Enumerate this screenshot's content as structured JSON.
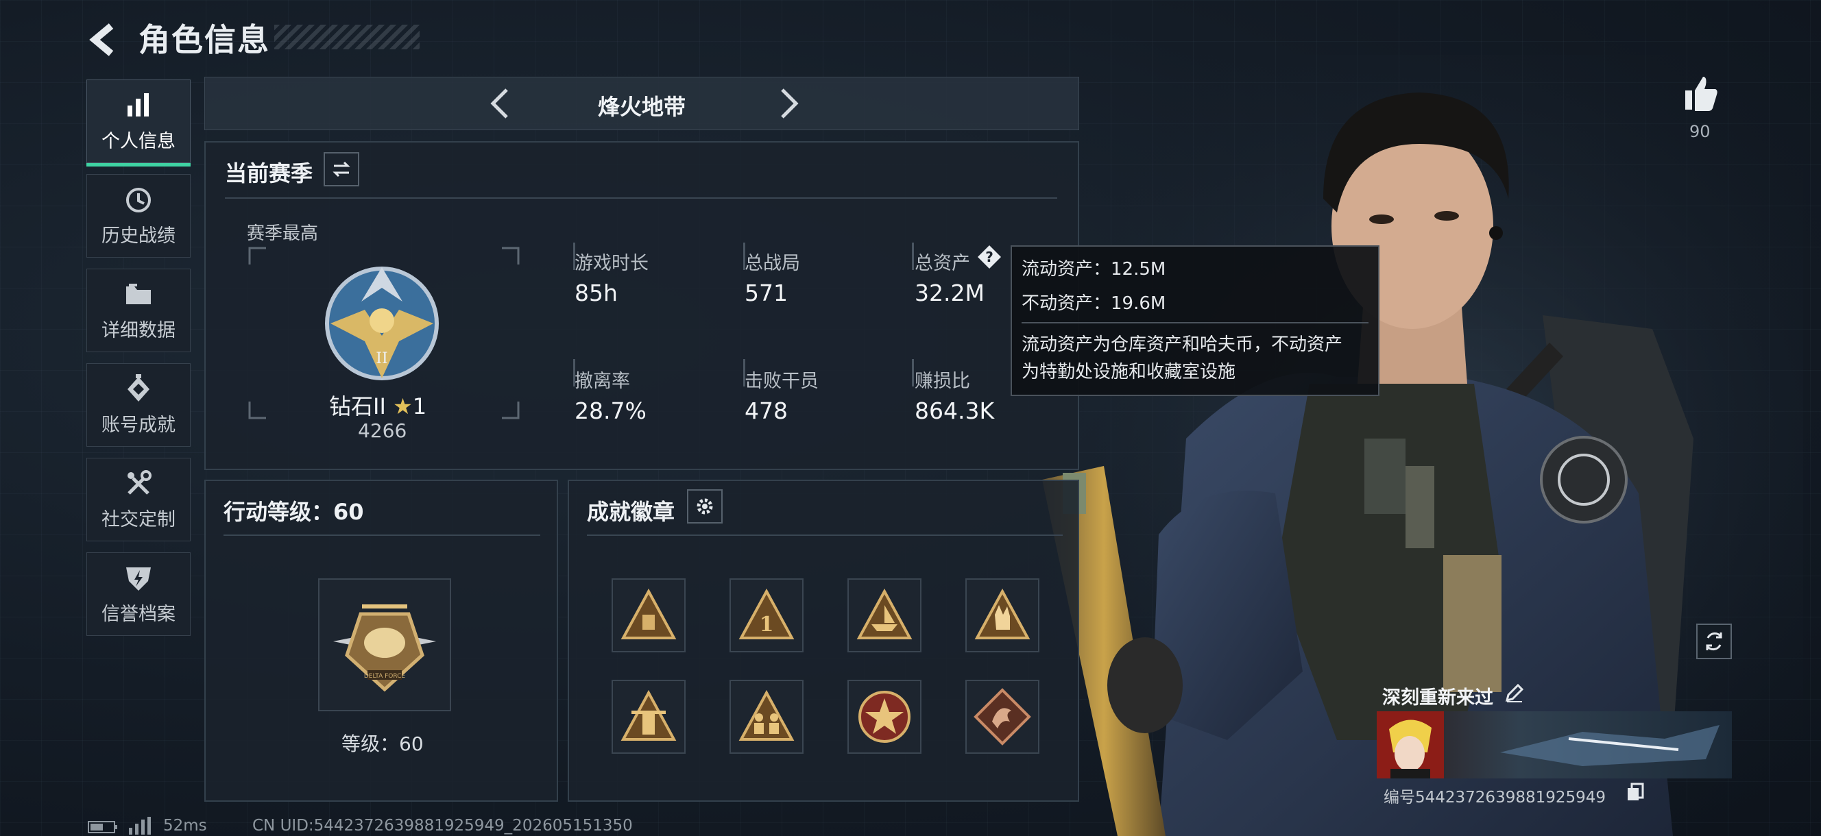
{
  "header": {
    "title": "角色信息"
  },
  "sidebar": {
    "items": [
      {
        "label": "个人信息",
        "icon": "bar-chart-icon",
        "active": true
      },
      {
        "label": "历史战绩",
        "icon": "history-icon"
      },
      {
        "label": "详细数据",
        "icon": "folder-icon"
      },
      {
        "label": "账号成就",
        "icon": "achievement-icon"
      },
      {
        "label": "社交定制",
        "icon": "tools-icon"
      },
      {
        "label": "信誉档案",
        "icon": "shield-lightning-icon"
      }
    ]
  },
  "mode_selector": {
    "label": "烽火地带"
  },
  "season": {
    "title": "当前赛季",
    "best_label": "赛季最高",
    "rank_name": "钻石II",
    "rank_stars": "1",
    "rank_score": "4266",
    "stats": [
      {
        "label": "游戏时长",
        "value": "85h"
      },
      {
        "label": "总战局",
        "value": "571"
      },
      {
        "label": "总资产",
        "value": "32.2M"
      },
      {
        "label": "撤离率",
        "value": "28.7%"
      },
      {
        "label": "击败干员",
        "value": "478"
      },
      {
        "label": "赚损比",
        "value": "864.3K"
      }
    ]
  },
  "tooltip": {
    "liquid": "流动资产：12.5M",
    "fixed": "不动资产：19.6M",
    "desc_line1": "流动资产为仓库资产和哈夫币，不动资产",
    "desc_line2": "为特勤处设施和收藏室设施"
  },
  "action_level": {
    "title": "行动等级：60",
    "level_label": "等级：60",
    "emblem_text": "DELTA FORCE"
  },
  "achievements": {
    "title": "成就徽章",
    "badges": [
      {
        "icon": "badge-pyramid-icon"
      },
      {
        "icon": "badge-number-one-icon",
        "text": "1"
      },
      {
        "icon": "badge-boat-icon"
      },
      {
        "icon": "badge-hand-sign-icon"
      },
      {
        "icon": "badge-tower-icon"
      },
      {
        "icon": "badge-squad-icon"
      },
      {
        "icon": "badge-star-medal-icon"
      },
      {
        "icon": "badge-dragon-icon"
      }
    ]
  },
  "likes": {
    "count": "90"
  },
  "player": {
    "name": "深刻重新来过",
    "id_label": "编号5442372639881925949"
  },
  "footer": {
    "ping": "52ms",
    "uid": "CN UID:5442372639881925949_202605151350"
  },
  "colors": {
    "accent": "#3fd3a3",
    "background": "#141c26",
    "gold": "#c9a24a"
  }
}
